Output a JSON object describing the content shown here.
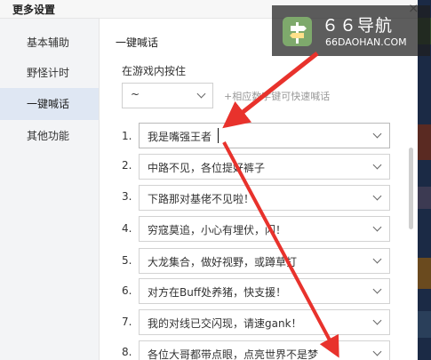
{
  "window": {
    "title": "更多设置",
    "close_glyph": "×"
  },
  "sidebar": {
    "items": [
      {
        "label": "基本辅助",
        "active": false
      },
      {
        "label": "野怪计时",
        "active": false
      },
      {
        "label": "一键喊话",
        "active": true
      },
      {
        "label": "其他功能",
        "active": false
      }
    ]
  },
  "main": {
    "section_title": "一键喊话",
    "trigger_label": "在游戏内按住",
    "trigger_key": "~",
    "hint": "+相应数字键可快速喊话",
    "rows": [
      {
        "num": "1.",
        "text": "我是嘴强王者"
      },
      {
        "num": "2.",
        "text": "中路不见，各位提好裤子"
      },
      {
        "num": "3.",
        "text": "下路那对基佬不见啦！"
      },
      {
        "num": "4.",
        "text": "穷寇莫追，小心有埋伏，闪！"
      },
      {
        "num": "5.",
        "text": "大龙集合，做好视野，或蹲草打"
      },
      {
        "num": "6.",
        "text": "对方在Buff处养猪，快支援！"
      },
      {
        "num": "7.",
        "text": "我的对线已交闪现，请速gank！"
      },
      {
        "num": "8.",
        "text": "各位大哥都带点眼，点亮世界不是梦"
      }
    ]
  },
  "watermark": {
    "name": "６６导航",
    "url": "66DAOHAN.COM",
    "icon": "signpost-icon"
  },
  "colors": {
    "arrow": "#e8322c",
    "sidebar_active": "#dfe7f3",
    "sidebar_bg": "#f3f4f6"
  }
}
